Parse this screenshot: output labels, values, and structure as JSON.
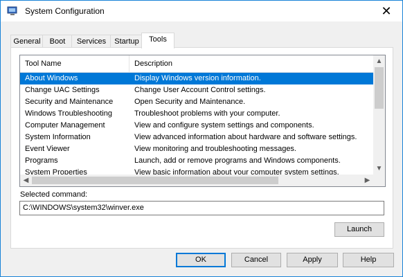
{
  "window": {
    "title": "System Configuration",
    "icon": "msconfig-icon"
  },
  "tabs": [
    {
      "label": "General",
      "active": false
    },
    {
      "label": "Boot",
      "active": false
    },
    {
      "label": "Services",
      "active": false
    },
    {
      "label": "Startup",
      "active": false
    },
    {
      "label": "Tools",
      "active": true
    }
  ],
  "list": {
    "columns": [
      "Tool Name",
      "Description"
    ],
    "rows": [
      {
        "name": "About Windows",
        "description": "Display Windows version information.",
        "selected": true
      },
      {
        "name": "Change UAC Settings",
        "description": "Change User Account Control settings."
      },
      {
        "name": "Security and Maintenance",
        "description": "Open Security and Maintenance."
      },
      {
        "name": "Windows Troubleshooting",
        "description": "Troubleshoot problems with your computer."
      },
      {
        "name": "Computer Management",
        "description": "View and configure system settings and components."
      },
      {
        "name": "System Information",
        "description": "View advanced information about hardware and software settings."
      },
      {
        "name": "Event Viewer",
        "description": "View monitoring and troubleshooting messages."
      },
      {
        "name": "Programs",
        "description": "Launch, add or remove programs and Windows components."
      },
      {
        "name": "System Properties",
        "description": "View basic information about your computer system settings."
      }
    ]
  },
  "selected_command": {
    "label": "Selected command:",
    "value": "C:\\WINDOWS\\system32\\winver.exe"
  },
  "buttons": {
    "launch": "Launch",
    "ok": "OK",
    "cancel": "Cancel",
    "apply": "Apply",
    "help": "Help"
  },
  "colors": {
    "selection": "#0078d7",
    "window_border": "#1883d7"
  }
}
